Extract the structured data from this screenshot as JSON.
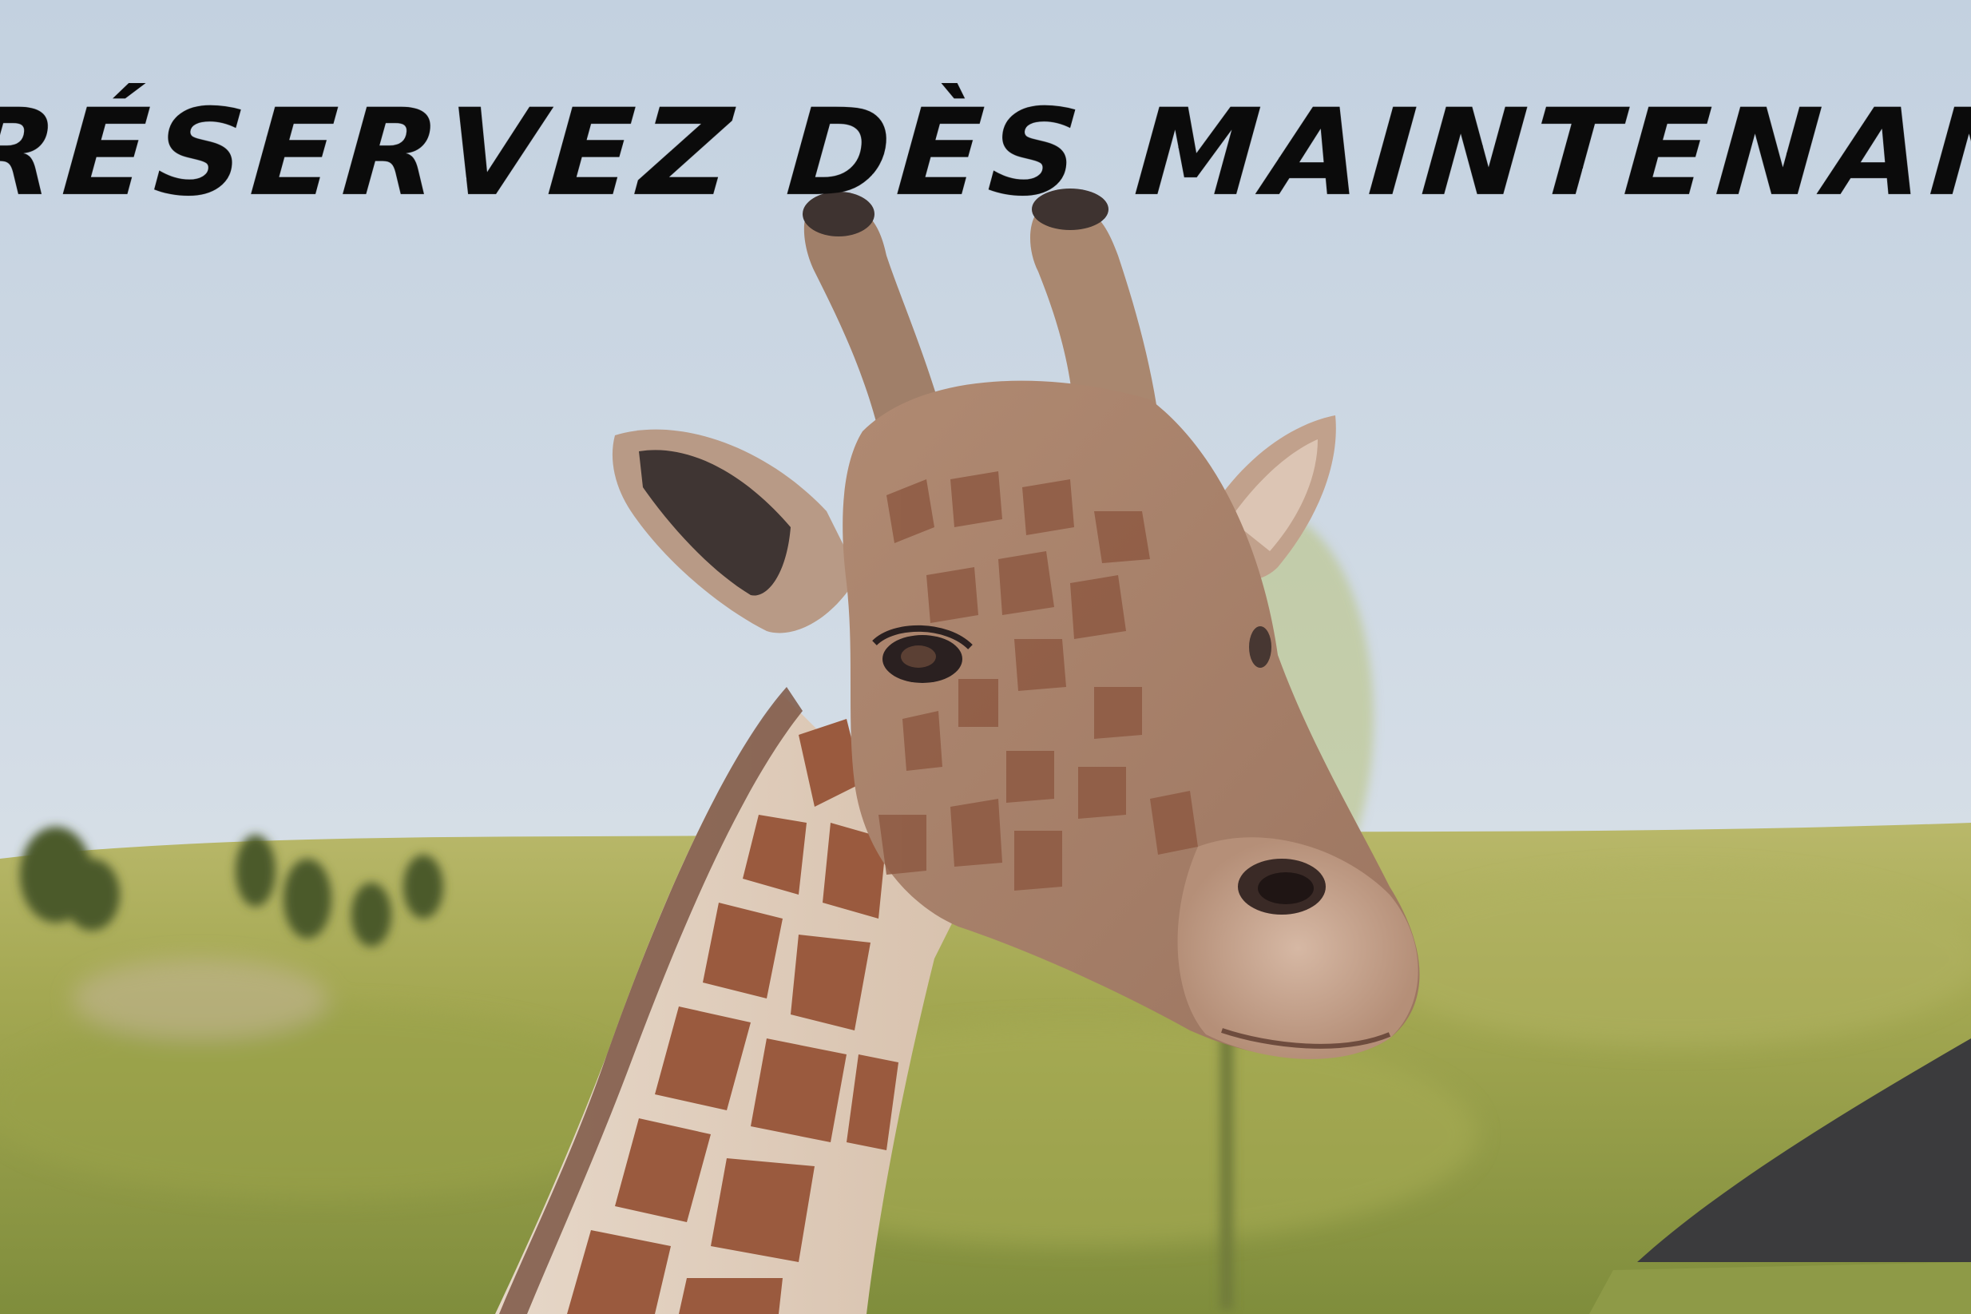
{
  "headline": "RÉSERVEZ DÈS MAINTENANT"
}
